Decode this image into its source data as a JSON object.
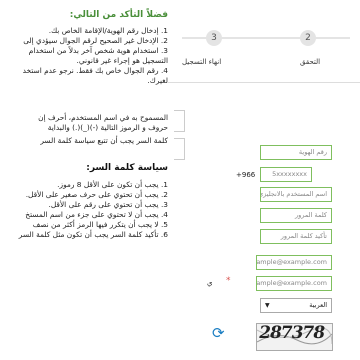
{
  "verify": {
    "heading": "فضلاً التأكد من التالي:",
    "items": [
      "1. إدخال رقم الهوية/الإقامة الخاص بك.",
      "2. الإدخال غير الصحيح لرقم الجوال سيؤدي إلى",
      "3. استخدام هوية شخص آخر بدلاً من استخدام",
      "   التسجيل هو إجراء غير قانوني.",
      "4. رقم الجوال خاص بك فقط. نرجو عدم استخد",
      "   لغيرك."
    ]
  },
  "username_rules": [
    "المسموح به في اسم المستخدم، أحرف إن",
    "حروف و الرموز التالية (-)(_)(.) والبداية",
    "كلمة السر يجب أن تتبع سياسة كلمة السر"
  ],
  "password_policy": {
    "heading": "سياسة كلمة السر:",
    "items": [
      "1. يجب أن تكون على الأقل 8 رموز.",
      "2. يجب أن تحتوي على حرف صغير على الأقل.",
      "3. يجب أن تحتوي على رقم على الأقل.",
      "4. يجب أن لا تحتوي على جزء من اسم المستخ",
      "5. لا يجب أن يتكرر فيها الرمز أكثر من نصف",
      "6. تأكيد كلمة السر يجب أن تكون مثل كلمة السر"
    ]
  },
  "wizard": {
    "steps": [
      {
        "number": "3",
        "label": "انهاء التسجيل"
      },
      {
        "number": "2",
        "label": "التحقق"
      }
    ]
  },
  "form": {
    "id_placeholder": "رقم الهوية",
    "phone_prefix": "+966",
    "phone_placeholder": "5xxxxxxxx",
    "username_placeholder": "اسم المستخدم بالانجليزي",
    "password_placeholder": "كلمة المرور",
    "confirm_password_placeholder": "تأكيد كلمة المرور",
    "email_placeholder": "example@example.com",
    "confirm_email_placeholder": "example@example.com",
    "partial_label": "ي",
    "required_mark": "*",
    "language_value": "العربية",
    "captcha_text": "287378"
  },
  "colors": {
    "field_border": "#7fbf5e",
    "refresh_icon": "#1b7ec2",
    "required": "#d9534f"
  }
}
